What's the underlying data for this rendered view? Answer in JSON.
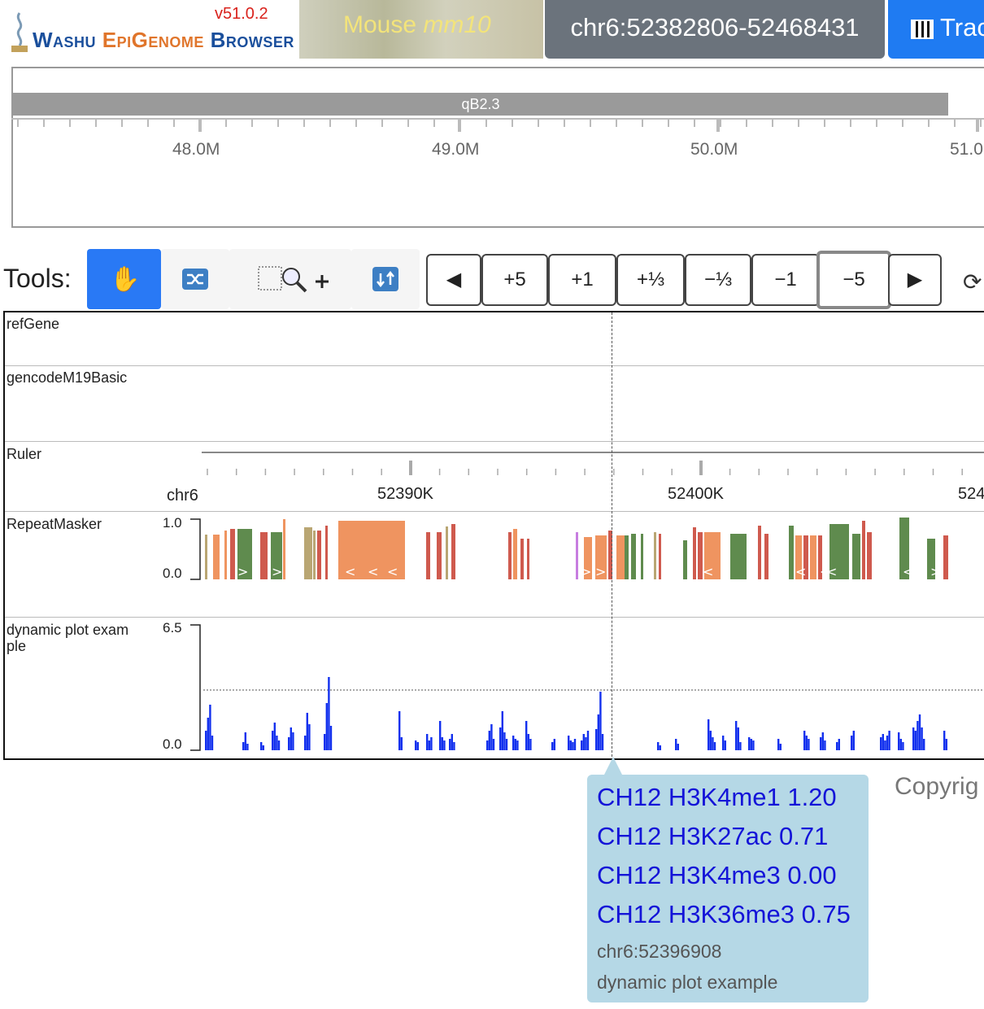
{
  "header": {
    "version": "v51.0.2",
    "logo_text_a": "Washu ",
    "logo_text_b": "EpiGenome",
    "logo_text_c": " Browser",
    "genome_species": "Mouse ",
    "genome_assembly": "mm10",
    "coordinates": "chr6:52382806-52468431",
    "tracks_label": "Trac"
  },
  "overview": {
    "band": "qB2.3",
    "ticks": [
      "48.0M",
      "49.0M",
      "50.0M",
      "51.0"
    ]
  },
  "tools": {
    "label": "Tools:",
    "nav": {
      "left": "◀",
      "plus5": "+5",
      "plus1": "+1",
      "plus_third": "+⅓",
      "minus_third": "−⅓",
      "minus1": "−1",
      "minus5": "−5",
      "right": "▶"
    }
  },
  "tracks": {
    "refgene": "refGene",
    "gencode": "gencodeM19Basic",
    "ruler": "Ruler",
    "ruler_chr": "chr6",
    "ruler_ticks": [
      "52390K",
      "52400K",
      "524"
    ],
    "repeatmasker": "RepeatMasker",
    "repeat_max": "1.0",
    "repeat_min": "0.0",
    "dynamic_line1": "dynamic plot exam",
    "dynamic_line2": "ple",
    "dynamic_max": "6.5",
    "dynamic_min": "0.0"
  },
  "tooltip": {
    "lines": [
      "CH12 H3K4me1 1.20",
      "CH12 H3K27ac 0.71",
      "CH12 H3K4me3 0.00",
      "CH12 H3K36me3 0.75"
    ],
    "position": "chr6:52396908",
    "track": "dynamic plot example"
  },
  "footer": {
    "copyright": "Copyrig"
  },
  "colors": {
    "accent": "#2979f5",
    "coords_bg": "#6b737c",
    "signal": "#1230ee",
    "tooltip_bg": "#b5d8e6",
    "repeat_orange": "#ef9460",
    "repeat_green": "#5f8b4e",
    "repeat_red": "#cf5a4e",
    "repeat_tan": "#b9a673"
  }
}
